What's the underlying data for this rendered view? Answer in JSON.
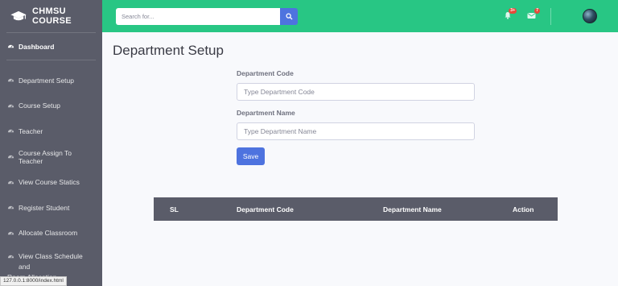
{
  "brand": {
    "name": "CHMSU COURSE"
  },
  "sidebar": {
    "dashboard": "Dashboard",
    "items": [
      {
        "label": "Department Setup",
        "icon": "gauge-icon"
      },
      {
        "label": "Course Setup",
        "icon": "gauge-icon"
      },
      {
        "label": "Teacher",
        "icon": "gauge-icon"
      },
      {
        "label": "Course Assign To Teacher",
        "icon": "gauge-icon"
      },
      {
        "label": "View Course Statics",
        "icon": "gauge-icon"
      },
      {
        "label": "Register Student",
        "icon": "gauge-icon"
      },
      {
        "label": "Allocate Classroom",
        "icon": "gauge-icon"
      },
      {
        "label": "View Class Schedule and",
        "label2": "Room Allocation",
        "icon": "gauge-icon"
      }
    ]
  },
  "topbar": {
    "search_placeholder": "Search for...",
    "alerts_badge": "3+",
    "messages_badge": "7"
  },
  "main": {
    "title": "Department Setup",
    "form": {
      "code_label": "Department Code",
      "code_placeholder": "Type Department Code",
      "name_label": "Department Name",
      "name_placeholder": "Type Department Name",
      "save_label": "Save"
    },
    "table": {
      "columns": [
        "SL",
        "Department Code",
        "Department Name",
        "Action"
      ]
    }
  },
  "status_url": "127.0.0.1:8000/index.html",
  "colors": {
    "topbar": "#28c684",
    "sidebar": "#5a5c69",
    "primary": "#4e73df",
    "badge": "#e74a3b"
  }
}
